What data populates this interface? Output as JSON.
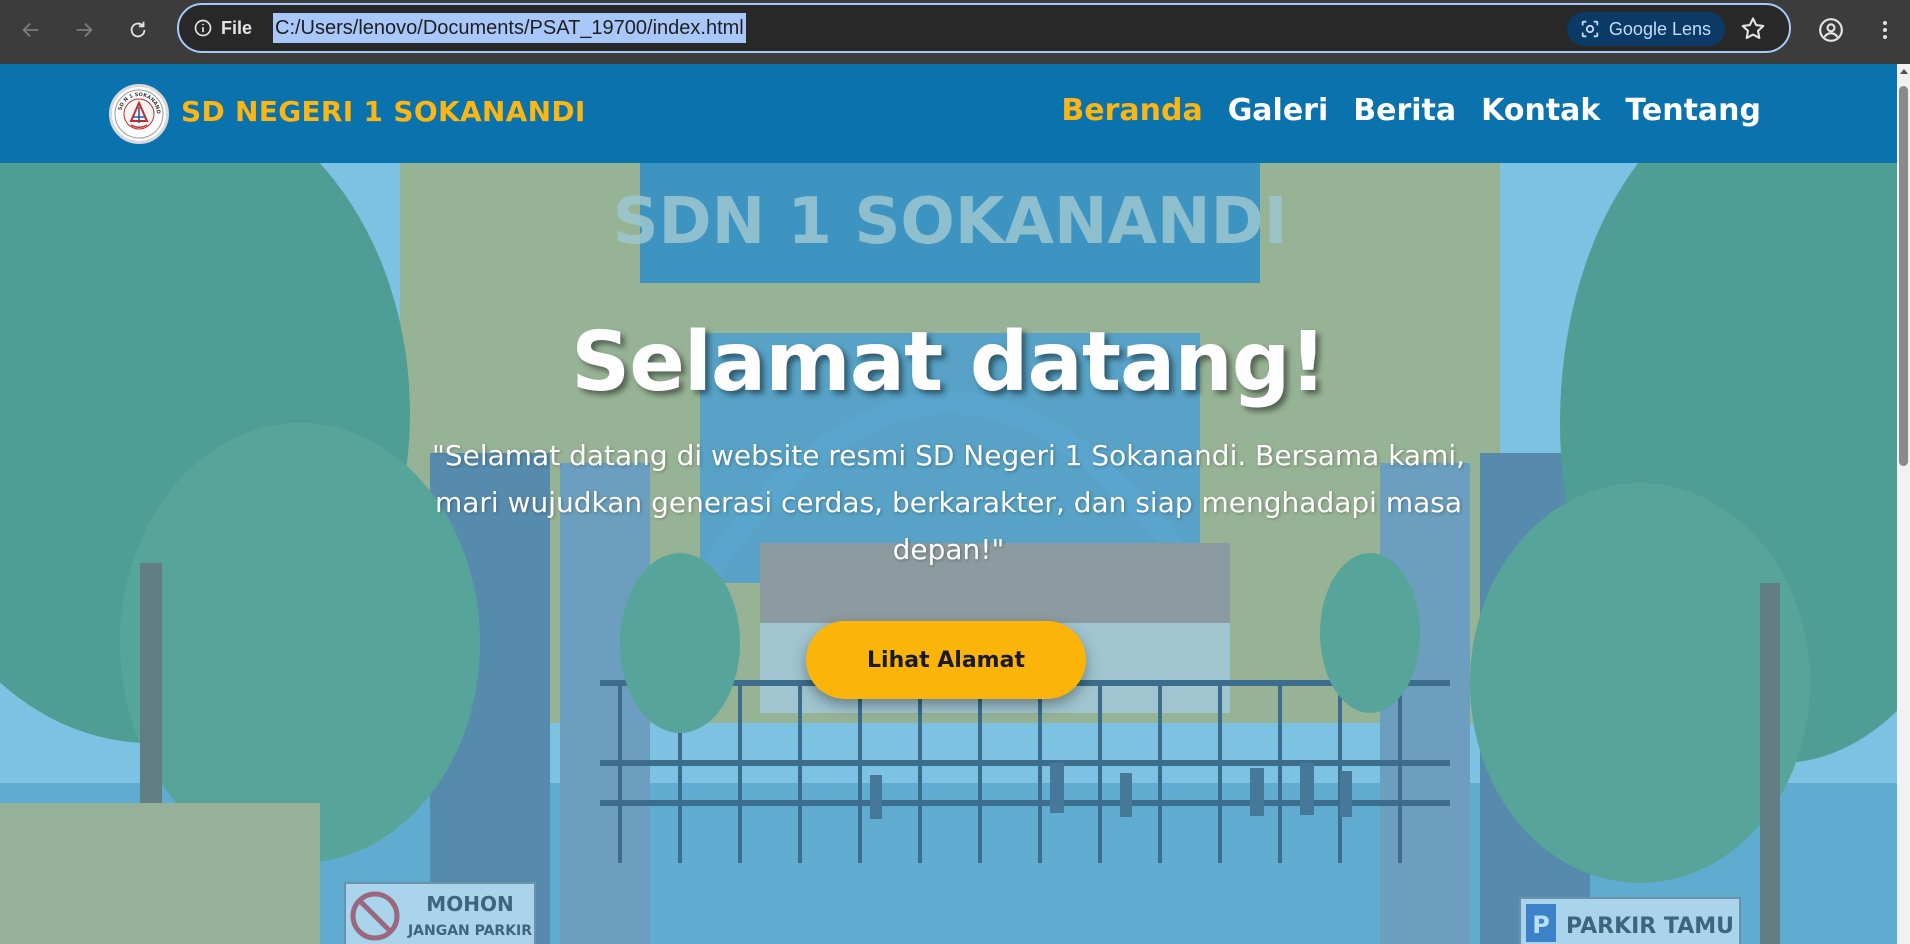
{
  "browser": {
    "site_info_label": "File",
    "url": "C:/Users/lenovo/Documents/PSAT_19700/index.html",
    "lens_label": "Google Lens",
    "icons": [
      "back-arrow-icon",
      "forward-arrow-icon",
      "reload-icon",
      "info-icon",
      "google-lens-icon",
      "star-icon",
      "profile-icon",
      "kebab-menu-icon"
    ]
  },
  "site": {
    "brand": "SD NEGERI 1 SOKANANDI",
    "logo_text": "SD N 1 SOKANANDI",
    "nav": [
      {
        "label": "Beranda",
        "active": true
      },
      {
        "label": "Galeri",
        "active": false
      },
      {
        "label": "Berita",
        "active": false
      },
      {
        "label": "Kontak",
        "active": false
      },
      {
        "label": "Tentang",
        "active": false
      }
    ],
    "colors": {
      "navbar": "#0a72ad",
      "accent": "#fbb615",
      "cta": "#fbb40a"
    }
  },
  "hero": {
    "title": "Selamat datang!",
    "text": "\"Selamat datang di website resmi SD Negeri 1 Sokanandi. Bersama kami, mari wujudkan generasi cerdas, berkarakter, dan siap menghadapi masa depan!\"",
    "cta_label": "Lihat Alamat",
    "background_signs": {
      "gate_sign": "SDN 1 SOKANANDI",
      "sign_left_line1": "MOHON",
      "sign_left_line2": "JANGAN PARKIR",
      "sign_right_letter": "P",
      "sign_right": "PARKIR TAMU"
    }
  }
}
